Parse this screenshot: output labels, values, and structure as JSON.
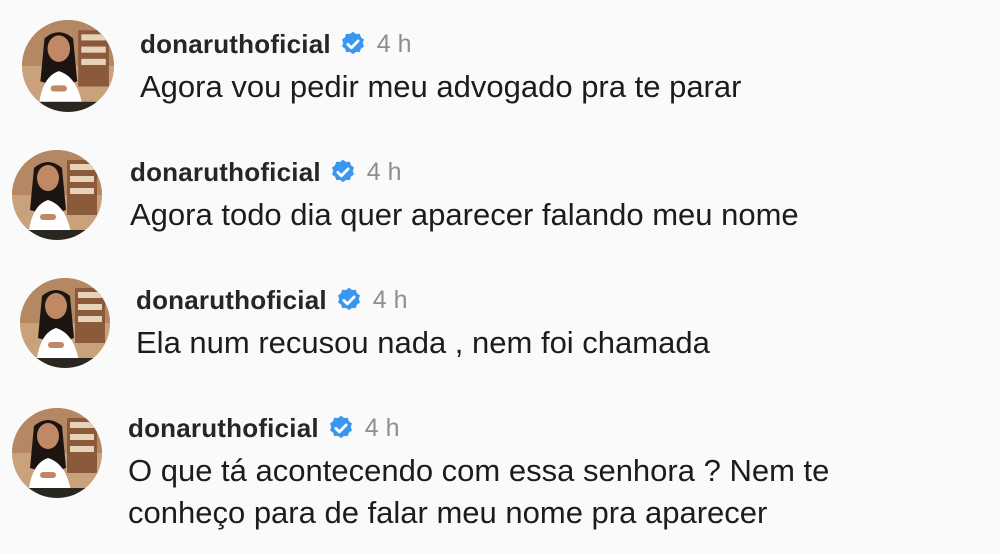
{
  "comments": [
    {
      "username": "donaruthoficial",
      "time": "4 h",
      "text": "Agora vou pedir meu advogado pra te parar"
    },
    {
      "username": "donaruthoficial",
      "time": "4 h",
      "text": "Agora todo dia quer aparecer falando meu nome"
    },
    {
      "username": "donaruthoficial",
      "time": "4 h",
      "text": "Ela num recusou nada , nem foi chamada"
    },
    {
      "username": "donaruthoficial",
      "time": "4 h",
      "text_line1": "O que tá acontecendo com essa senhora ? Nem te",
      "text_line2": "conheço para de falar meu nome pra aparecer"
    }
  ],
  "icons": {
    "verified": "verified-badge-icon",
    "avatar": "profile-photo"
  },
  "colors": {
    "verified_badge": "#3897f0",
    "username": "#262626",
    "timestamp": "#8e8e8e",
    "background": "#fafafa"
  }
}
